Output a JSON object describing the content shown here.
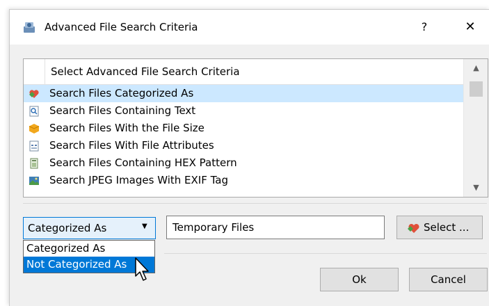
{
  "window": {
    "title": "Advanced File Search Criteria",
    "help_label": "?",
    "close_label": "✕"
  },
  "list": {
    "header": "Select Advanced File Search Criteria",
    "items": [
      {
        "label": "Search Files Categorized As",
        "icon": "category-heart-icon",
        "selected": true
      },
      {
        "label": "Search Files Containing Text",
        "icon": "text-search-icon",
        "selected": false
      },
      {
        "label": "Search Files With the File Size",
        "icon": "file-size-icon",
        "selected": false
      },
      {
        "label": "Search Files With File Attributes",
        "icon": "file-attributes-icon",
        "selected": false
      },
      {
        "label": "Search Files Containing HEX Pattern",
        "icon": "hex-pattern-icon",
        "selected": false
      },
      {
        "label": "Search JPEG Images With EXIF Tag",
        "icon": "jpeg-exif-icon",
        "selected": false
      }
    ],
    "scroll_up": "▲",
    "scroll_down": "▼"
  },
  "category_combo": {
    "value": "Categorized As",
    "arrow": "▼",
    "options": [
      "Categorized As",
      "Not Categorized As"
    ],
    "hovered_option": "Not Categorized As"
  },
  "category_input": {
    "value": "Temporary Files"
  },
  "buttons": {
    "select": "Select ...",
    "ok": "Ok",
    "cancel": "Cancel"
  },
  "colors": {
    "selection": "#cce8ff",
    "accent": "#0078d7",
    "dialog_bg": "#f0f0f0",
    "button_bg": "#e1e1e1"
  }
}
